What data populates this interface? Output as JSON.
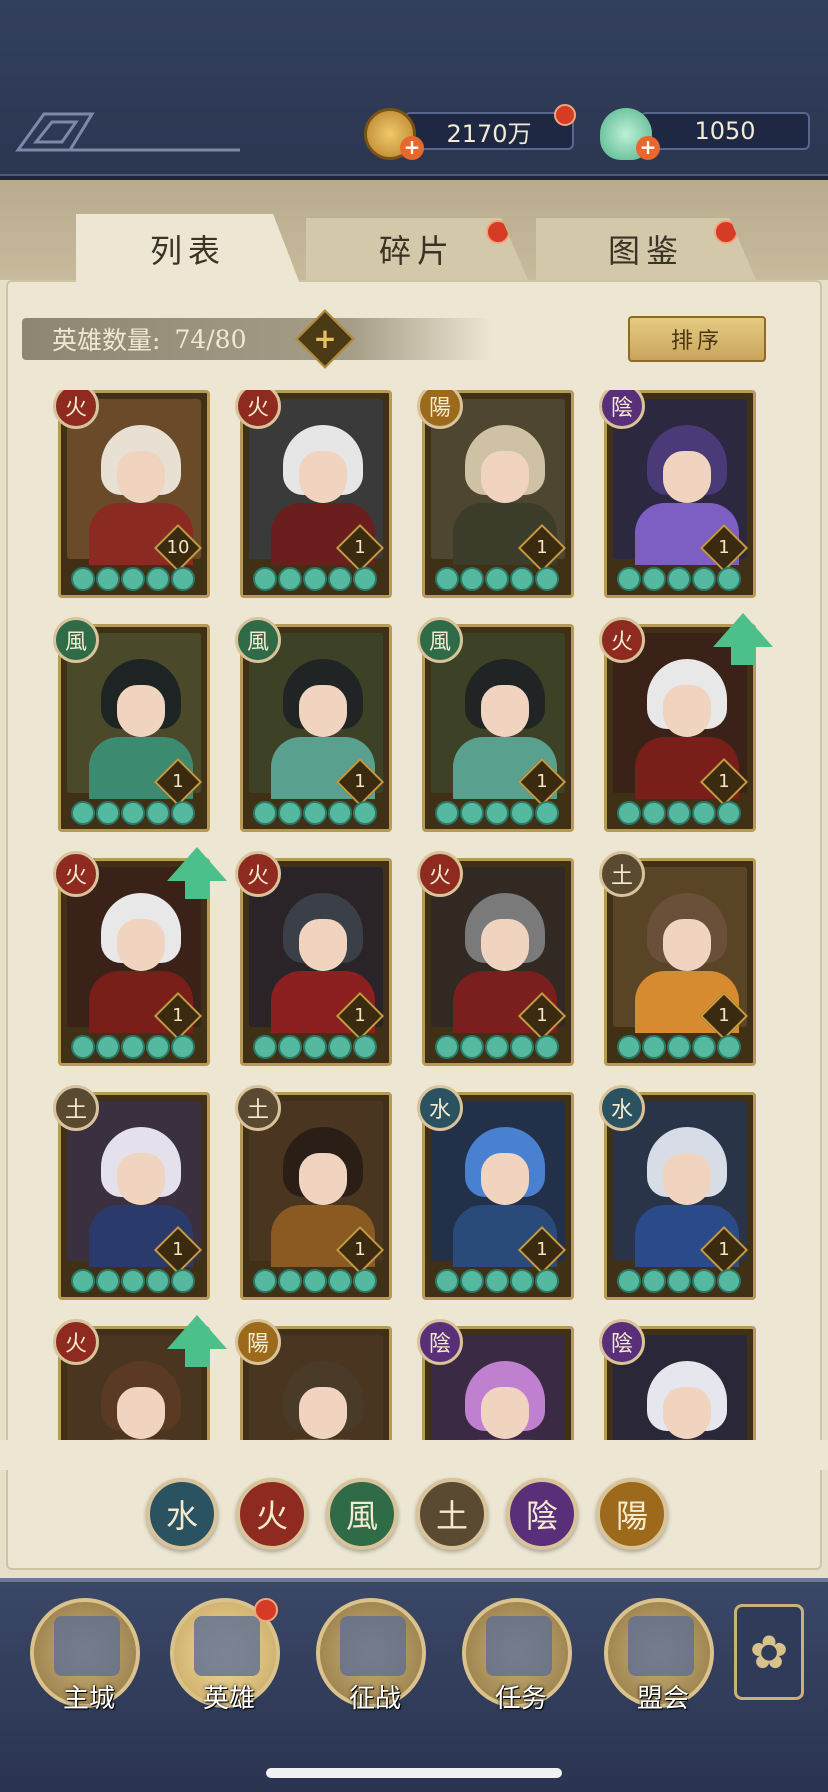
{
  "resources": {
    "coins": {
      "value": "2170万",
      "icon": "copper-coin-icon"
    },
    "jade": {
      "value": "1050",
      "icon": "jade-shell-icon"
    }
  },
  "tabs": [
    {
      "label": "列表",
      "active": true
    },
    {
      "label": "碎片",
      "active": false,
      "badge": true
    },
    {
      "label": "图鉴",
      "active": false,
      "badge": true
    }
  ],
  "hero_count": {
    "label": "英雄数量:",
    "value": "74/80"
  },
  "sort_label": "排序",
  "elements": {
    "fire": {
      "char": "火",
      "color": "#8e2a1f"
    },
    "wind": {
      "char": "風",
      "color": "#2f6b47"
    },
    "earth": {
      "char": "土",
      "color": "#5a4a32"
    },
    "water": {
      "char": "水",
      "color": "#2a5260"
    },
    "yin": {
      "char": "陰",
      "color": "#5a2f7a"
    },
    "yang": {
      "char": "陽",
      "color": "#9c6a1a"
    }
  },
  "heroes": [
    {
      "element": "fire",
      "level": "10",
      "stars": 5
    },
    {
      "element": "fire",
      "level": "1",
      "stars": 5
    },
    {
      "element": "yang",
      "level": "1",
      "stars": 5
    },
    {
      "element": "yin",
      "level": "1",
      "stars": 5
    },
    {
      "element": "wind",
      "level": "1",
      "stars": 5
    },
    {
      "element": "wind",
      "level": "1",
      "stars": 5
    },
    {
      "element": "wind",
      "level": "1",
      "stars": 5
    },
    {
      "element": "fire",
      "level": "1",
      "stars": 5,
      "upgrade": true
    },
    {
      "element": "fire",
      "level": "1",
      "stars": 5,
      "upgrade": true
    },
    {
      "element": "fire",
      "level": "1",
      "stars": 5
    },
    {
      "element": "fire",
      "level": "1",
      "stars": 5
    },
    {
      "element": "earth",
      "level": "1",
      "stars": 5
    },
    {
      "element": "earth",
      "level": "1",
      "stars": 5
    },
    {
      "element": "earth",
      "level": "1",
      "stars": 5
    },
    {
      "element": "water",
      "level": "1",
      "stars": 5
    },
    {
      "element": "water",
      "level": "1",
      "stars": 5
    },
    {
      "element": "fire",
      "level": "",
      "stars": 0,
      "upgrade": true
    },
    {
      "element": "yang",
      "level": "",
      "stars": 0
    },
    {
      "element": "yin",
      "level": "",
      "stars": 0
    },
    {
      "element": "yin",
      "level": "",
      "stars": 0
    }
  ],
  "filters": [
    "water",
    "fire",
    "wind",
    "earth",
    "yin",
    "yang"
  ],
  "nav": [
    {
      "label": "主城",
      "icon": "city-gate-icon"
    },
    {
      "label": "英雄",
      "icon": "hero-portrait-icon",
      "active": true,
      "badge": true
    },
    {
      "label": "征战",
      "icon": "battle-icon"
    },
    {
      "label": "任务",
      "icon": "scroll-task-icon"
    },
    {
      "label": "盟会",
      "icon": "alliance-hall-icon"
    }
  ],
  "menu_icon": "flower-menu-icon"
}
